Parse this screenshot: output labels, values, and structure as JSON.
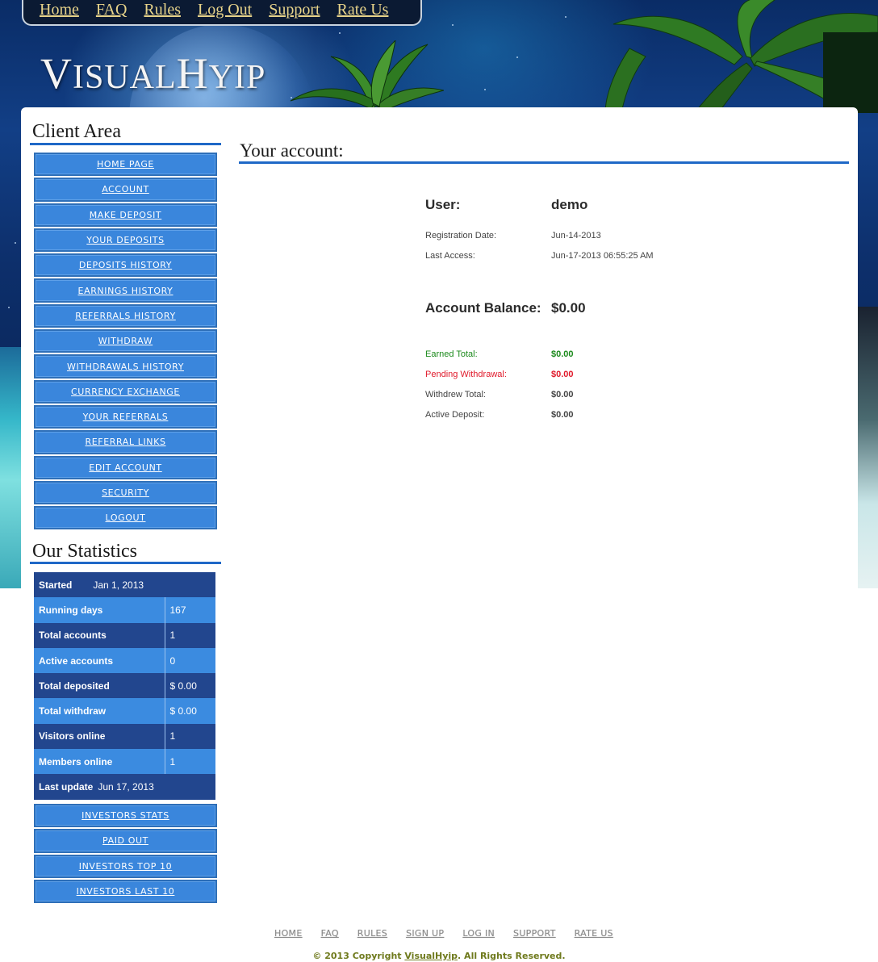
{
  "top_nav": [
    "Home",
    "FAQ",
    "Rules",
    "Log Out",
    "Support",
    "Rate Us"
  ],
  "logo": {
    "v": "V",
    "isual": "ISUAL",
    "h": "H",
    "yip": "YIP"
  },
  "client_area": {
    "title": "Client Area",
    "menu": [
      "Home Page",
      "Account",
      "Make Deposit",
      "Your Deposits",
      "Deposits History",
      "Earnings History",
      "Referrals History",
      "Withdraw",
      "Withdrawals History",
      "Currency Exchange",
      "Your Referrals",
      "Referral Links",
      "Edit Account",
      "Security",
      "Logout"
    ]
  },
  "statistics": {
    "title": "Our Statistics",
    "started_label": "Started",
    "started_value": "Jan 1, 2013",
    "rows": [
      {
        "label": "Running days",
        "value": "167"
      },
      {
        "label": "Total accounts",
        "value": "1"
      },
      {
        "label": "Active accounts",
        "value": "0"
      },
      {
        "label": "Total deposited",
        "value": "$ 0.00"
      },
      {
        "label": "Total withdraw",
        "value": "$ 0.00"
      },
      {
        "label": "Visitors online",
        "value": "1"
      },
      {
        "label": "Members online",
        "value": "1"
      }
    ],
    "last_update_label": "Last update",
    "last_update_value": "Jun 17, 2013",
    "links": [
      "Investors Stats",
      "Paid Out",
      "Investors Top 10",
      "Investors Last 10"
    ]
  },
  "account": {
    "title": "Your account:",
    "user_label": "User:",
    "user_value": "demo",
    "registration_label": "Registration Date:",
    "registration_value": "Jun-14-2013",
    "last_access_label": "Last Access:",
    "last_access_value": "Jun-17-2013 06:55:25 AM",
    "balance_label": "Account Balance:",
    "balance_value": "$0.00",
    "earned_label": "Earned Total:",
    "earned_value": "$0.00",
    "pending_label": "Pending Withdrawal:",
    "pending_value": "$0.00",
    "withdrew_label": "Withdrew Total:",
    "withdrew_value": "$0.00",
    "active_label": "Active Deposit:",
    "active_value": "$0.00"
  },
  "footer": {
    "links": [
      "HOME",
      "FAQ",
      "RULES",
      "SIGN UP",
      "LOG IN",
      "SUPPORT",
      "RATE US"
    ],
    "copyright_prefix": "© 2013 Copyright ",
    "copyright_brand": "VisualHyip",
    "copyright_suffix": ". All Rights Reserved."
  },
  "colors": {
    "menu_blue": "#3a86dc",
    "stats_dark": "#22468e",
    "rule_blue": "#1f68c7",
    "nav_gold": "#e7d38a",
    "earned_green": "#1c8a1c",
    "pending_red": "#e0192a"
  }
}
